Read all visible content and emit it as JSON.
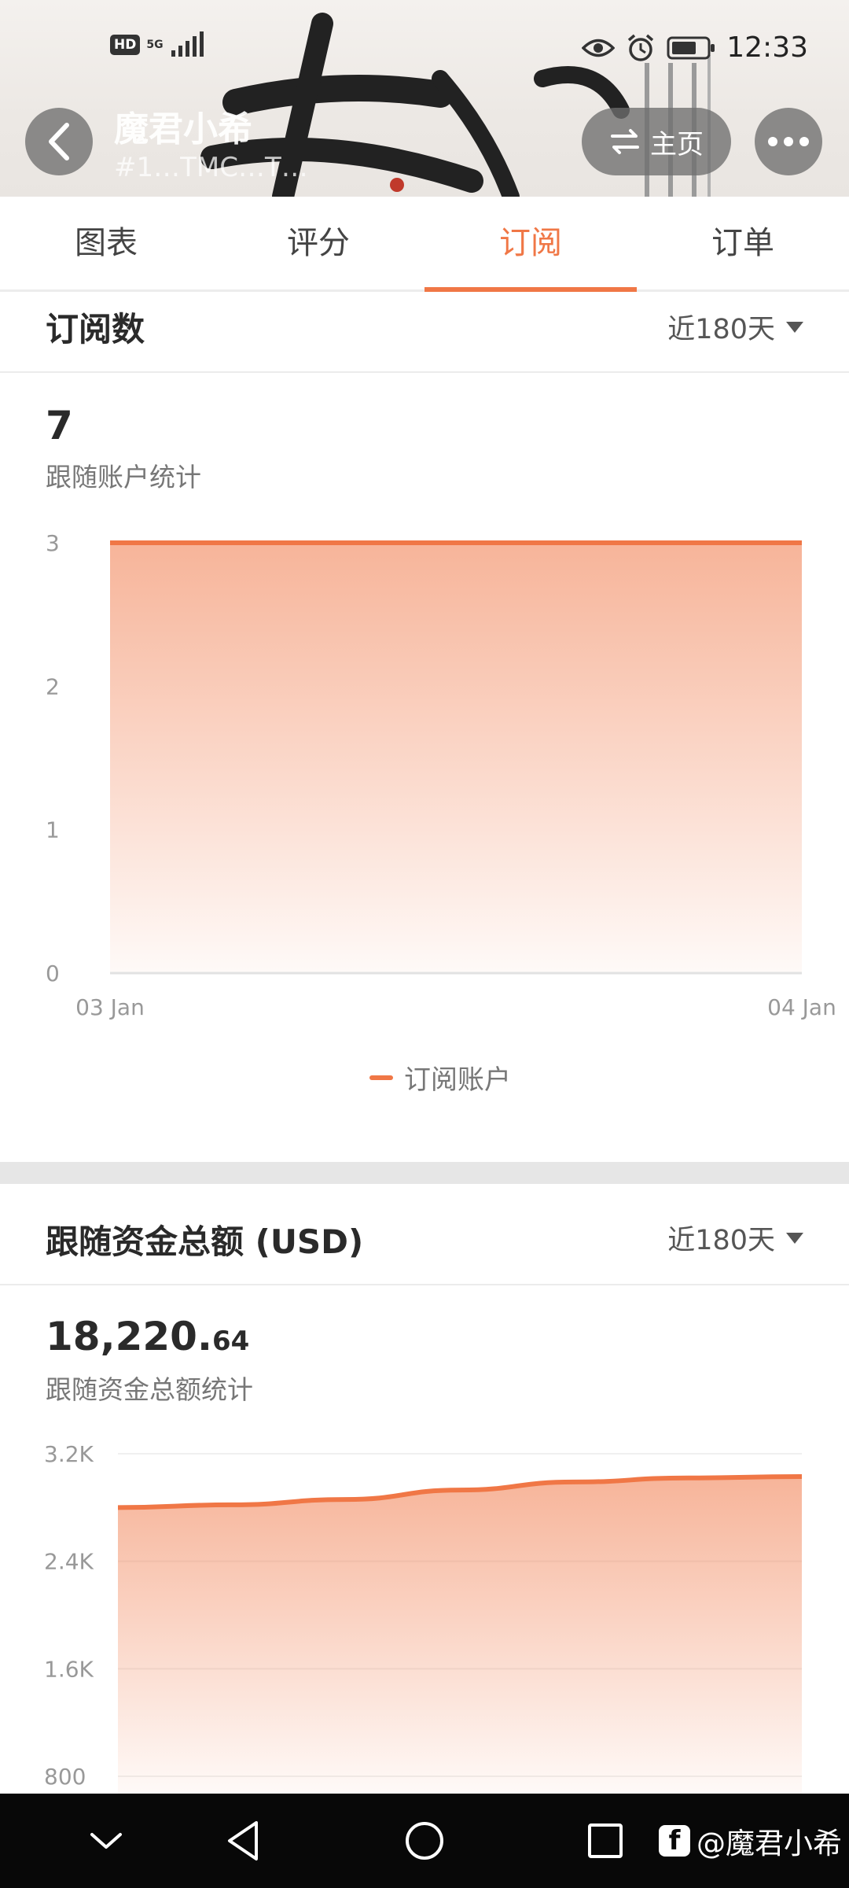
{
  "status_bar": {
    "hd": "HD",
    "network": "5G",
    "time": "12:33"
  },
  "header": {
    "name": "魔君小希",
    "id_text": "#1…TMC…T…",
    "home_label": "主页"
  },
  "tabs": [
    {
      "label": "图表",
      "active": false
    },
    {
      "label": "评分",
      "active": false
    },
    {
      "label": "订阅",
      "active": true
    },
    {
      "label": "订单",
      "active": false
    }
  ],
  "subscriptions": {
    "title": "订阅数",
    "range": "近180天",
    "count": "7",
    "count_label": "跟随账户统计",
    "legend": "订阅账户"
  },
  "funds": {
    "title": "跟随资金总额 (USD)",
    "range": "近180天",
    "amount_int": "18,220.",
    "amount_dec": "64",
    "amount_label": "跟随资金总额统计"
  },
  "chart_data": [
    {
      "type": "area",
      "x": [
        "03 Jan",
        "04 Jan"
      ],
      "series": [
        {
          "name": "订阅账户",
          "values": [
            3,
            3
          ]
        }
      ],
      "y_ticks": [
        "0",
        "1",
        "2",
        "3"
      ],
      "ylim": [
        0,
        3
      ],
      "x_tick_labels": [
        "03 Jan",
        "04 Jan"
      ],
      "color": "#f07746"
    },
    {
      "type": "area",
      "values": [
        2800,
        2820,
        2860,
        2930,
        2990,
        3020,
        3030
      ],
      "y_ticks": [
        "800",
        "1.6K",
        "2.4K",
        "3.2K"
      ],
      "ylim": [
        800,
        3200
      ],
      "color": "#f07746"
    }
  ],
  "nav_bar": {
    "watermark": "@魔君小希"
  },
  "colors": {
    "accent": "#f07746",
    "nav_bg": "#080808"
  }
}
